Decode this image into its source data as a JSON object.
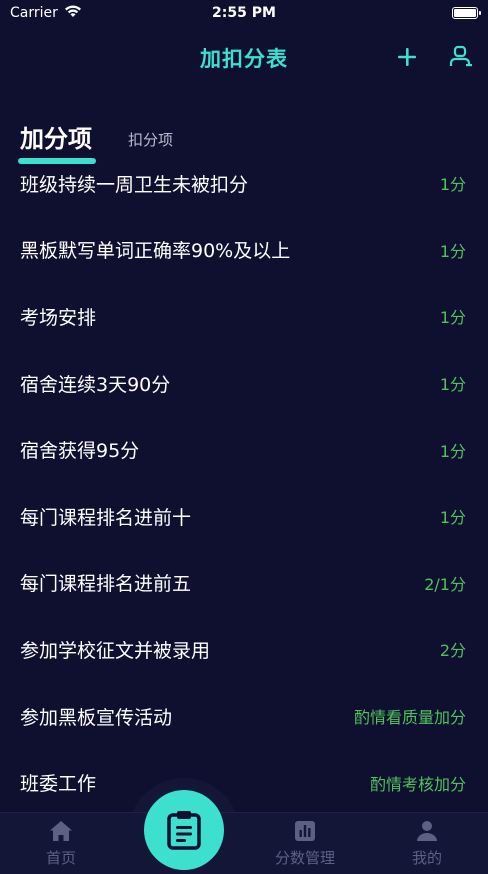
{
  "status_bar": {
    "carrier": "Carrier",
    "time": "2:55 PM"
  },
  "nav": {
    "title": "加扣分表",
    "add_icon": "plus-icon",
    "manage_icon": "user-icon"
  },
  "tabs": [
    {
      "label": "加分项",
      "active": true
    },
    {
      "label": "扣分项",
      "active": false
    }
  ],
  "items": [
    {
      "title": "班级持续一周卫生未被扣分",
      "score": "1分"
    },
    {
      "title": "黑板默写单词正确率90%及以上",
      "score": "1分"
    },
    {
      "title": "考场安排",
      "score": "1分"
    },
    {
      "title": "宿舍连续3天90分",
      "score": "1分"
    },
    {
      "title": "宿舍获得95分",
      "score": "1分"
    },
    {
      "title": "每门课程排名进前十",
      "score": "1分"
    },
    {
      "title": "每门课程排名进前五",
      "score": "2/1分"
    },
    {
      "title": "参加学校征文并被录用",
      "score": "2分"
    },
    {
      "title": "参加黑板宣传活动",
      "score": "酌情看质量加分"
    },
    {
      "title": "班委工作",
      "score": "酌情考核加分"
    }
  ],
  "tabbar": {
    "home": "首页",
    "scores": "分数管理",
    "mine": "我的"
  },
  "colors": {
    "accent": "#3de0cf",
    "background": "#0f1030",
    "score_green": "#4fc25a",
    "inactive": "#5c6082"
  }
}
